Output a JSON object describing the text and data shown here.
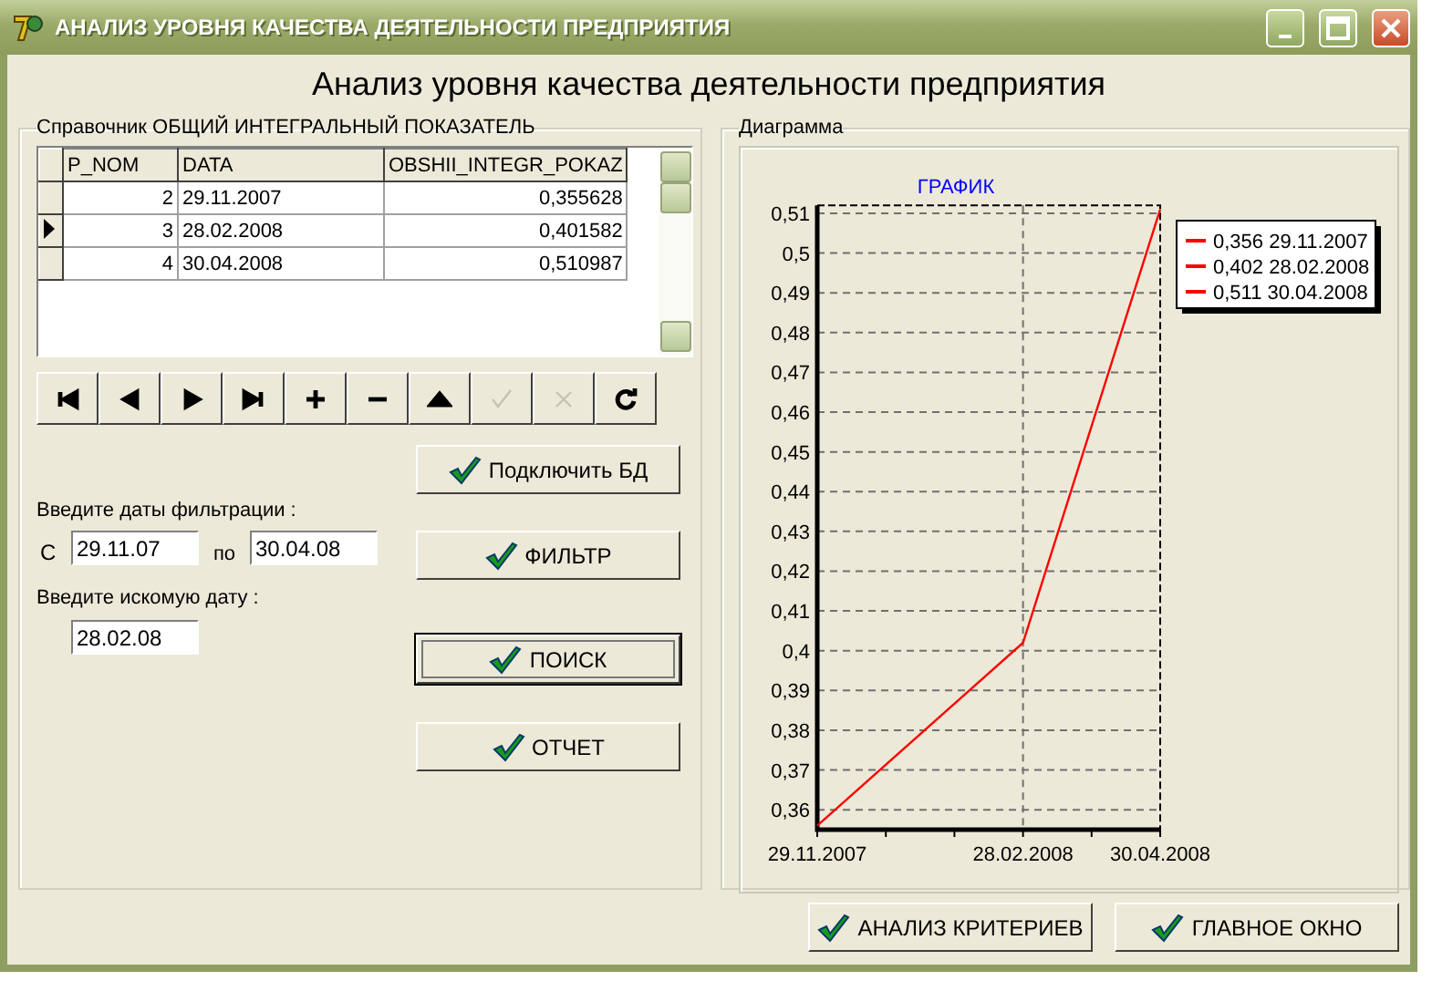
{
  "window": {
    "title": "АНАЛИЗ УРОВНЯ КАЧЕСТВА ДЕЯТЕЛЬНОСТИ ПРЕДПРИЯТИЯ"
  },
  "heading": "Анализ уровня качества деятельности предприятия",
  "table_group": {
    "title": "Справочник ОБЩИЙ ИНТЕГРАЛЬНЫЙ ПОКАЗАТЕЛЬ",
    "columns": [
      "P_NOM",
      "DATA",
      "OBSHII_INTEGR_POKAZ"
    ],
    "rows": [
      {
        "cells": [
          "2",
          "29.11.2007",
          "0,355628"
        ],
        "selected": false
      },
      {
        "cells": [
          "3",
          "28.02.2008",
          "0,401582"
        ],
        "selected": true
      },
      {
        "cells": [
          "4",
          "30.04.2008",
          "0,510987"
        ],
        "selected": false
      }
    ]
  },
  "navigator": [
    {
      "kind": "first",
      "disabled": false
    },
    {
      "kind": "prior",
      "disabled": false
    },
    {
      "kind": "next",
      "disabled": false
    },
    {
      "kind": "last",
      "disabled": false
    },
    {
      "kind": "insert",
      "disabled": false
    },
    {
      "kind": "delete",
      "disabled": false
    },
    {
      "kind": "edit",
      "disabled": false
    },
    {
      "kind": "post",
      "disabled": true
    },
    {
      "kind": "cancel",
      "disabled": true
    },
    {
      "kind": "refresh",
      "disabled": false
    }
  ],
  "filter": {
    "label": "Введите даты фильтрации :",
    "from_label": "С",
    "from_value": "29.11.07",
    "to_label": "по",
    "to_value": "30.04.08"
  },
  "search": {
    "label": "Введите искомую дату :",
    "value": "28.02.08"
  },
  "buttons": [
    {
      "label": "Подключить БД",
      "focused": false
    },
    {
      "label": "ФИЛЬТР",
      "focused": false
    },
    {
      "label": "ПОИСК",
      "focused": true
    },
    {
      "label": "ОТЧЕТ",
      "focused": false
    }
  ],
  "diagram": {
    "title": "Диаграмма",
    "chart_data": {
      "type": "line",
      "title": "ГРАФИК",
      "categories": [
        "29.11.2007",
        null,
        null,
        "28.02.2008",
        null,
        "30.04.2008"
      ],
      "series": [
        {
          "color": "#ff0000",
          "values": [
            0.356,
            null,
            null,
            0.402,
            null,
            0.511
          ]
        }
      ],
      "ylim": [
        0.355,
        0.512
      ],
      "grid": true,
      "yticks": [
        {
          "value": 0.36,
          "label": "0,36"
        },
        {
          "value": 0.37,
          "label": "0,37"
        },
        {
          "value": 0.38,
          "label": "0,38"
        },
        {
          "value": 0.39,
          "label": "0,39"
        },
        {
          "value": 0.4,
          "label": "0,4"
        },
        {
          "value": 0.41,
          "label": "0,41"
        },
        {
          "value": 0.42,
          "label": "0,42"
        },
        {
          "value": 0.43,
          "label": "0,43"
        },
        {
          "value": 0.44,
          "label": "0,44"
        },
        {
          "value": 0.45,
          "label": "0,45"
        },
        {
          "value": 0.46,
          "label": "0,46"
        },
        {
          "value": 0.47,
          "label": "0,47"
        },
        {
          "value": 0.48,
          "label": "0,48"
        },
        {
          "value": 0.49,
          "label": "0,49"
        },
        {
          "value": 0.5,
          "label": "0,5"
        },
        {
          "value": 0.51,
          "label": "0,51"
        }
      ]
    },
    "legend": [
      {
        "text": "0,356 29.11.2007",
        "color": "#ff0000"
      },
      {
        "text": "0,402 28.02.2008",
        "color": "#ff0000"
      },
      {
        "text": "0,511 30.04.2008",
        "color": "#ff0000"
      }
    ]
  },
  "footer_buttons": [
    {
      "label": "АНАЛИЗ КРИТЕРИЕВ"
    },
    {
      "label": "ГЛАВНОЕ ОКНО"
    }
  ]
}
